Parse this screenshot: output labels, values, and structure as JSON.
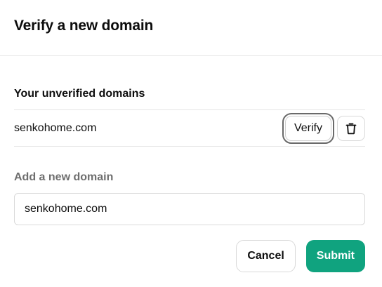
{
  "dialog": {
    "title": "Verify a new domain"
  },
  "unverified": {
    "heading": "Your unverified domains",
    "domains": [
      {
        "name": "senkohome.com",
        "verify_label": "Verify",
        "delete_icon": "trash-icon"
      }
    ]
  },
  "new_domain": {
    "label": "Add a new domain",
    "value": "senkohome.com"
  },
  "footer": {
    "cancel_label": "Cancel",
    "submit_label": "Submit"
  },
  "colors": {
    "submit_bg": "#10a37f",
    "label_muted": "#6e6e6e",
    "divider": "#e5e5e5"
  }
}
